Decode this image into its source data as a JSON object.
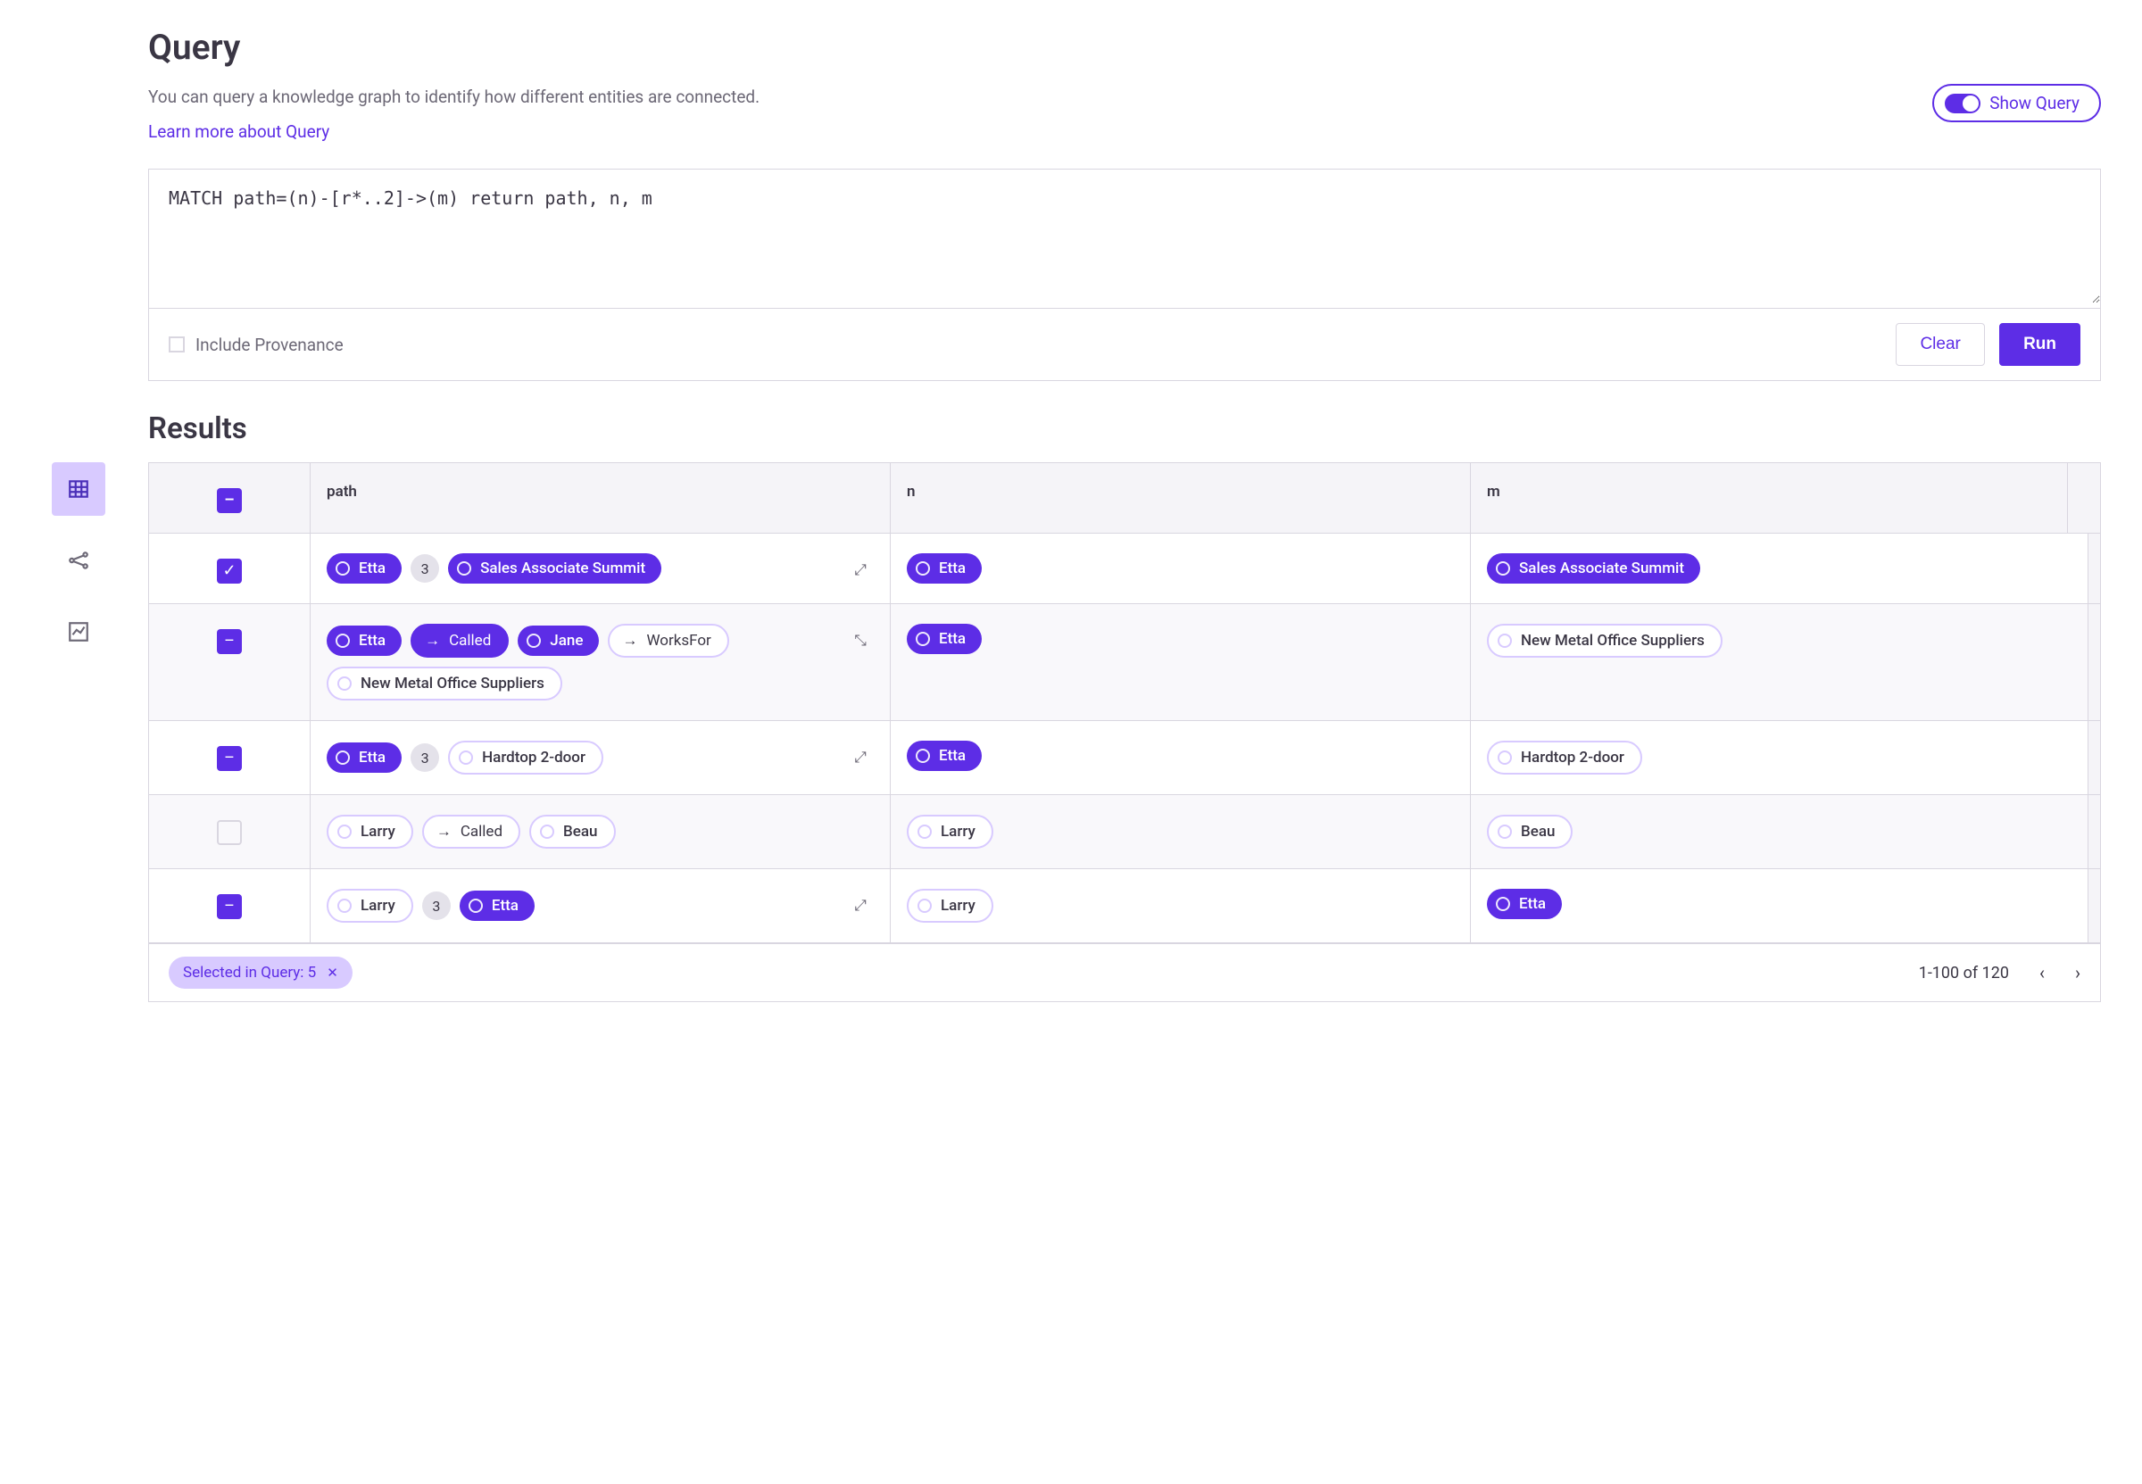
{
  "header": {
    "title": "Query",
    "intro": "You can query a knowledge graph to identify how different entities are connected.",
    "learn_more": "Learn more about Query",
    "show_query_label": "Show Query"
  },
  "query": {
    "text": "MATCH path=(n)-[r*..2]->(m) return path, n, m",
    "include_provenance_label": "Include Provenance",
    "clear_label": "Clear",
    "run_label": "Run"
  },
  "results": {
    "title": "Results",
    "columns": {
      "path": "path",
      "n": "n",
      "m": "m"
    },
    "rows": [
      {
        "select_state": "checked",
        "expand": "expand",
        "path": [
          {
            "kind": "node",
            "style": "filled",
            "label": "Etta"
          },
          {
            "kind": "count",
            "label": "3"
          },
          {
            "kind": "node",
            "style": "filled",
            "label": "Sales Associate Summit"
          }
        ],
        "n": {
          "style": "filled",
          "label": "Etta"
        },
        "m": {
          "style": "filled",
          "label": "Sales Associate Summit"
        }
      },
      {
        "select_state": "partial",
        "expand": "collapse",
        "path": [
          {
            "kind": "node",
            "style": "filled",
            "label": "Etta"
          },
          {
            "kind": "rel",
            "style": "filled",
            "label": "Called"
          },
          {
            "kind": "node",
            "style": "filled",
            "label": "Jane"
          },
          {
            "kind": "rel",
            "style": "outline",
            "label": "WorksFor"
          },
          {
            "kind": "node",
            "style": "outline",
            "label": "New Metal Office Suppliers"
          }
        ],
        "n": {
          "style": "filled",
          "label": "Etta"
        },
        "m": {
          "style": "outline",
          "label": "New Metal Office Suppliers"
        }
      },
      {
        "select_state": "partial",
        "expand": "expand",
        "path": [
          {
            "kind": "node",
            "style": "filled",
            "label": "Etta"
          },
          {
            "kind": "count",
            "label": "3"
          },
          {
            "kind": "node",
            "style": "outline",
            "label": "Hardtop 2-door"
          }
        ],
        "n": {
          "style": "filled",
          "label": "Etta"
        },
        "m": {
          "style": "outline",
          "label": "Hardtop 2-door"
        }
      },
      {
        "select_state": "empty",
        "expand": "none",
        "path": [
          {
            "kind": "node",
            "style": "outline",
            "label": "Larry"
          },
          {
            "kind": "rel",
            "style": "outline",
            "label": "Called"
          },
          {
            "kind": "node",
            "style": "outline",
            "label": "Beau"
          }
        ],
        "n": {
          "style": "outline",
          "label": "Larry"
        },
        "m": {
          "style": "outline",
          "label": "Beau"
        }
      },
      {
        "select_state": "partial",
        "expand": "expand",
        "path": [
          {
            "kind": "node",
            "style": "outline",
            "label": "Larry"
          },
          {
            "kind": "count",
            "label": "3"
          },
          {
            "kind": "node",
            "style": "filled",
            "label": "Etta"
          }
        ],
        "n": {
          "style": "outline",
          "label": "Larry"
        },
        "m": {
          "style": "filled",
          "label": "Etta"
        }
      }
    ],
    "footer": {
      "selection_chip": "Selected in Query: 5",
      "range_label": "1-100 of 120"
    },
    "header_select_state": "partial"
  },
  "glyphs": {
    "expand": "⤢",
    "collapse": "⤡",
    "minus": "–",
    "check": "✓",
    "arrow_right": "→",
    "chevron_left": "‹",
    "chevron_right": "›",
    "close": "✕"
  }
}
